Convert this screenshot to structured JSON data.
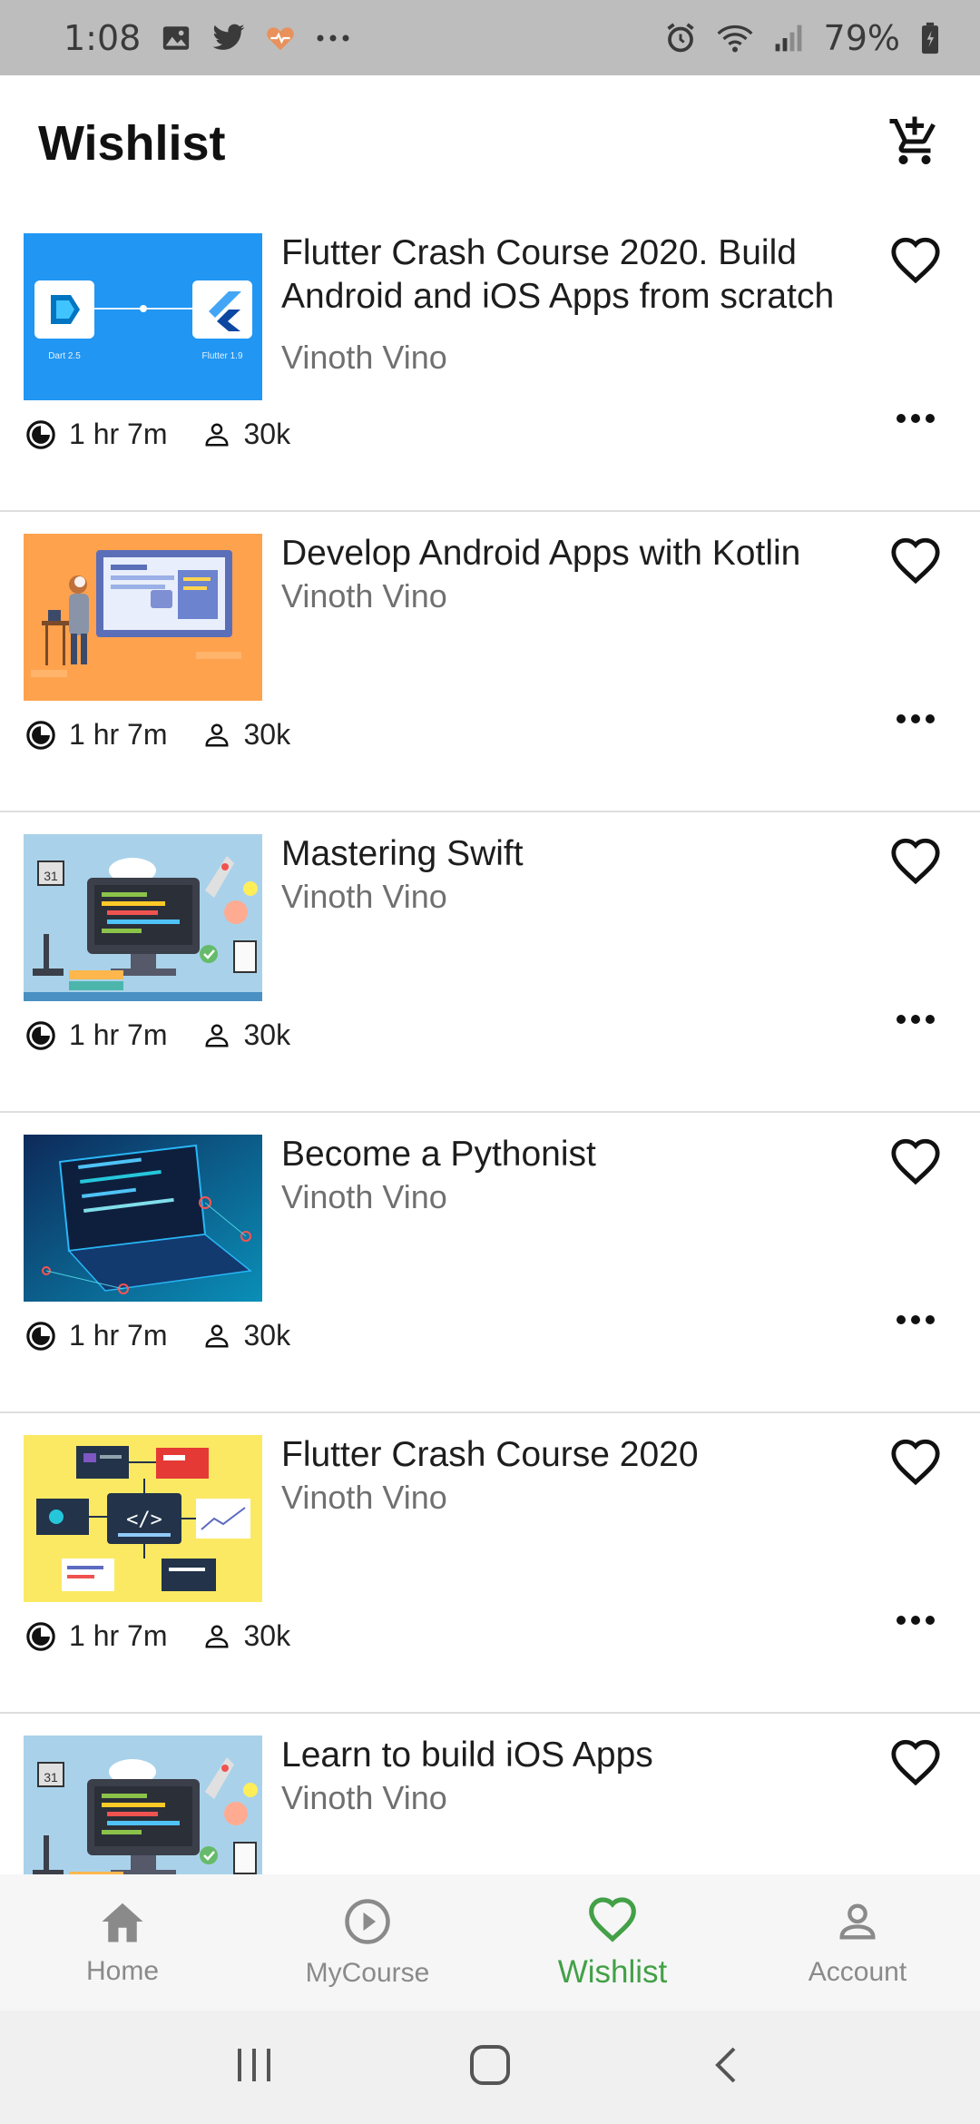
{
  "status_bar": {
    "time": "1:08",
    "battery_pct": "79%",
    "left_icons": [
      "gallery-icon",
      "twitter-icon",
      "health-icon",
      "more-dots-icon"
    ],
    "right_icons": [
      "alarm-icon",
      "wifi-icon",
      "signal-icon",
      "battery-icon"
    ]
  },
  "app_bar": {
    "title": "Wishlist",
    "cart_icon": "add-to-cart-icon"
  },
  "colors": {
    "accent": "#43a047",
    "nav_inactive": "#8a8a8a",
    "status_bar_bg": "#bdbdbd",
    "author_gray": "#707070"
  },
  "courses": [
    {
      "title": "Flutter Crash Course 2020. Build Android and iOS Apps from scratch",
      "author": "Vinoth Vino",
      "duration": "1 hr 7m",
      "students": "30k",
      "thumb": "flutter-dart",
      "thumb_labels": [
        "Dart 2.5",
        "Flutter 1.9"
      ]
    },
    {
      "title": "Develop Android Apps with Kotlin",
      "author": "Vinoth Vino",
      "duration": "1 hr 7m",
      "students": "30k",
      "thumb": "developer-board"
    },
    {
      "title": "Mastering Swift",
      "author": "Vinoth Vino",
      "duration": "1 hr 7m",
      "students": "30k",
      "thumb": "coding-desk"
    },
    {
      "title": "Become a Pythonist",
      "author": "Vinoth Vino",
      "duration": "1 hr 7m",
      "students": "30k",
      "thumb": "laptop-neon"
    },
    {
      "title": "Flutter Crash Course 2020",
      "author": "Vinoth Vino",
      "duration": "1 hr 7m",
      "students": "30k",
      "thumb": "code-network"
    },
    {
      "title": "Learn to build iOS Apps",
      "author": "Vinoth Vino",
      "duration": "",
      "students": "",
      "thumb": "coding-desk"
    }
  ],
  "bottom_nav": {
    "items": [
      {
        "label": "Home",
        "icon": "home-icon",
        "active": false
      },
      {
        "label": "MyCourse",
        "icon": "play-circle-icon",
        "active": false
      },
      {
        "label": "Wishlist",
        "icon": "heart-icon",
        "active": true
      },
      {
        "label": "Account",
        "icon": "person-icon",
        "active": false
      }
    ]
  },
  "system_nav": {
    "buttons": [
      "recents-icon",
      "home-circle-icon",
      "back-icon"
    ]
  }
}
